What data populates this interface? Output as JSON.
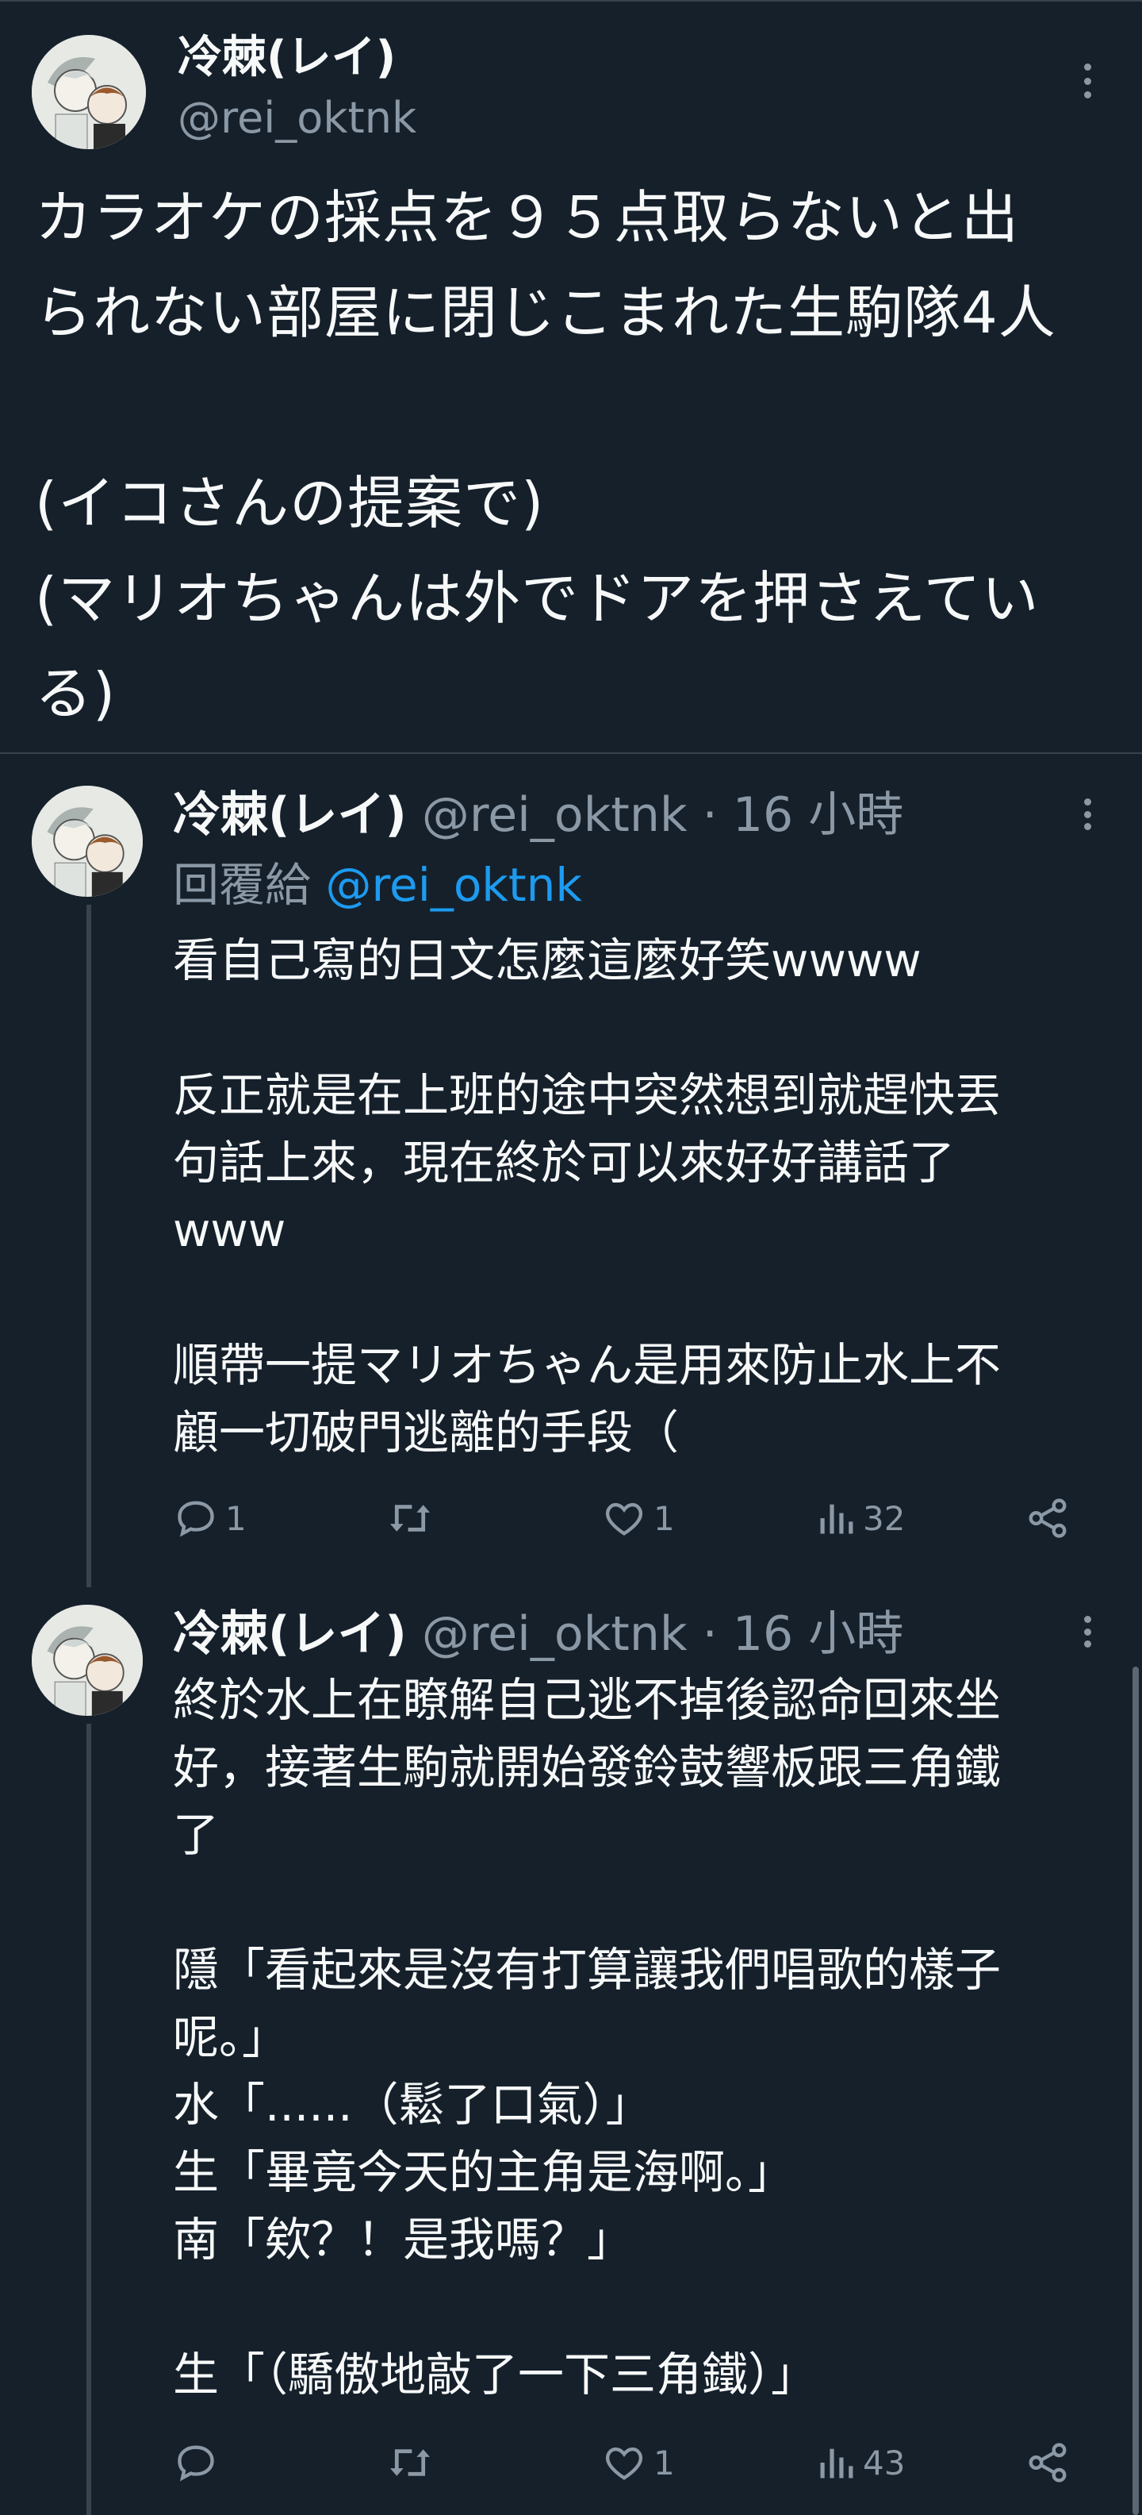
{
  "main_tweet": {
    "display_name": "冷棘(レイ)",
    "handle": "@rei_oktnk",
    "text": "カラオケの採点を９５点取らないと出\nられない部屋に閉じこまれた生駒隊4人\n\n(イコさんの提案で)\n(マリオちゃんは外でドアを押さえてい\nる)",
    "avatar_icon": "avatar-icon",
    "more_icon": "more-options-icon"
  },
  "replies": [
    {
      "display_name": "冷棘(レイ)",
      "meta": "@rei_oktnk · 16 小時",
      "reply_label": "回覆給",
      "reply_mention": "@rei_oktnk",
      "text": "看自己寫的日文怎麼這麼好笑wwww\n\n反正就是在上班的途中突然想到就趕快丟\n句話上來，現在終於可以來好好講話了\nwww\n\n順帶一提マリオちゃん是用來防止水上不\n顧一切破門逃離的手段（",
      "actions": {
        "replies": "1",
        "retweets": "",
        "likes": "1",
        "views": "32"
      }
    },
    {
      "display_name": "冷棘(レイ)",
      "meta": "@rei_oktnk · 16 小時",
      "text": "終於水上在瞭解自己逃不掉後認命回來坐\n好，接著生駒就開始發鈴鼓響板跟三角鐵\n了\n\n隱「看起來是沒有打算讓我們唱歌的樣子\n呢。」\n水「......（鬆了口氣）」\n生「畢竟今天的主角是海啊。」\n南「欸？！是我嗎？」\n\n生「（驕傲地敲了一下三角鐵）」",
      "actions": {
        "replies": "",
        "retweets": "",
        "likes": "1",
        "views": "43"
      }
    }
  ],
  "colors": {
    "background": "#15202b",
    "text": "#f7f9f9",
    "secondary": "#8b98a5",
    "link": "#1d9bf0",
    "border": "#38444d"
  }
}
